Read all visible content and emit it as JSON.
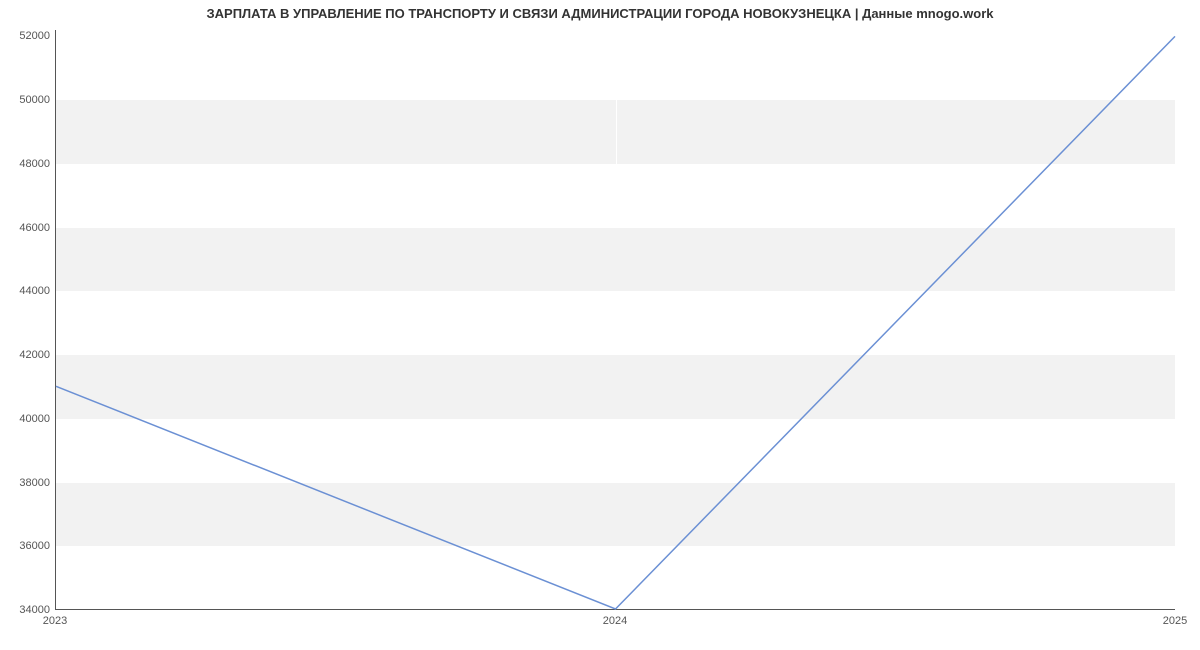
{
  "chart_data": {
    "type": "line",
    "title": "ЗАРПЛАТА В УПРАВЛЕНИЕ ПО ТРАНСПОРТУ И СВЯЗИ АДМИНИСТРАЦИИ ГОРОДА НОВОКУЗНЕЦКА | Данные mnogo.work",
    "x": [
      2023,
      2024,
      2025
    ],
    "values": [
      41000,
      34000,
      52000
    ],
    "xlabel": "",
    "ylabel": "",
    "x_ticks": [
      "2023",
      "2024",
      "2025"
    ],
    "y_ticks": [
      34000,
      36000,
      38000,
      40000,
      42000,
      44000,
      46000,
      48000,
      50000,
      52000
    ],
    "ylim": [
      34000,
      52200
    ],
    "line_color": "#6b90d4",
    "band_color": "#f2f2f2"
  }
}
